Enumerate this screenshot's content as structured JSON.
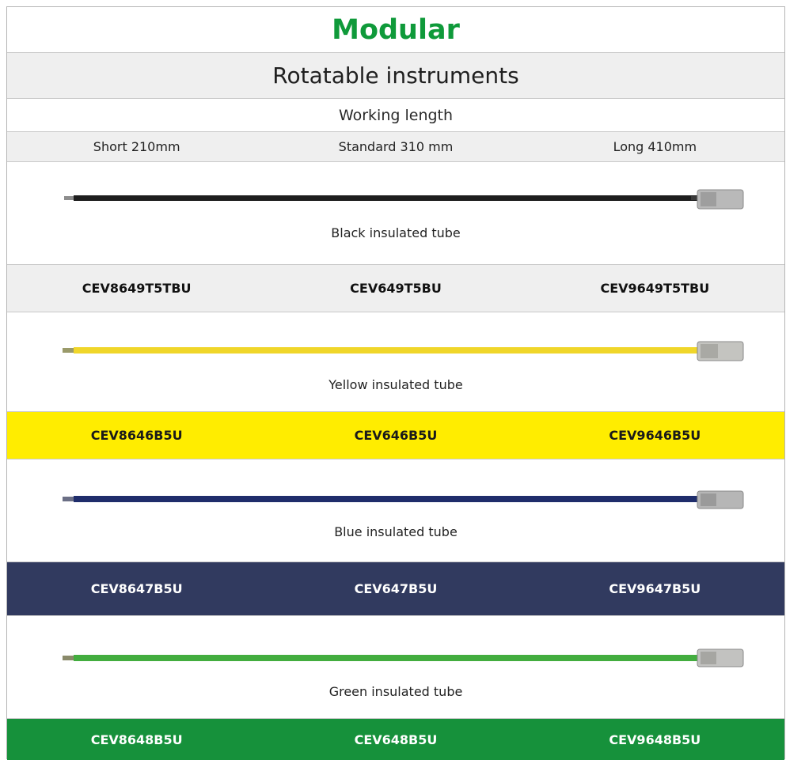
{
  "header": {
    "title": "Modular",
    "subtitle": "Rotatable instruments",
    "working_length_label": "Working length"
  },
  "lengths": [
    "Short 210mm",
    "Standard 310 mm",
    "Long 410mm"
  ],
  "colors": {
    "title_green": "#0f9a3a",
    "black_tube": "#1e1e1e",
    "yellow_tube": "#f0d62a",
    "blue_tube": "#1f2d6b",
    "green_tube": "#43ad3f",
    "yellow_band": "#ffed00",
    "navy_band": "#313a5f",
    "green_band": "#16913b",
    "light_band": "#efefef"
  },
  "rows": [
    {
      "tube_label": "Black insulated tube",
      "codes": [
        "CEV8649T5TBU",
        "CEV649T5BU",
        "CEV9649T5TBU"
      ]
    },
    {
      "tube_label": "Yellow insulated tube",
      "codes": [
        "CEV8646B5U",
        "CEV646B5U",
        "CEV9646B5U"
      ]
    },
    {
      "tube_label": "Blue insulated tube",
      "codes": [
        "CEV8647B5U",
        "CEV647B5U",
        "CEV9647B5U"
      ]
    },
    {
      "tube_label": "Green insulated tube",
      "codes": [
        "CEV8648B5U",
        "CEV648B5U",
        "CEV9648B5U"
      ]
    }
  ]
}
